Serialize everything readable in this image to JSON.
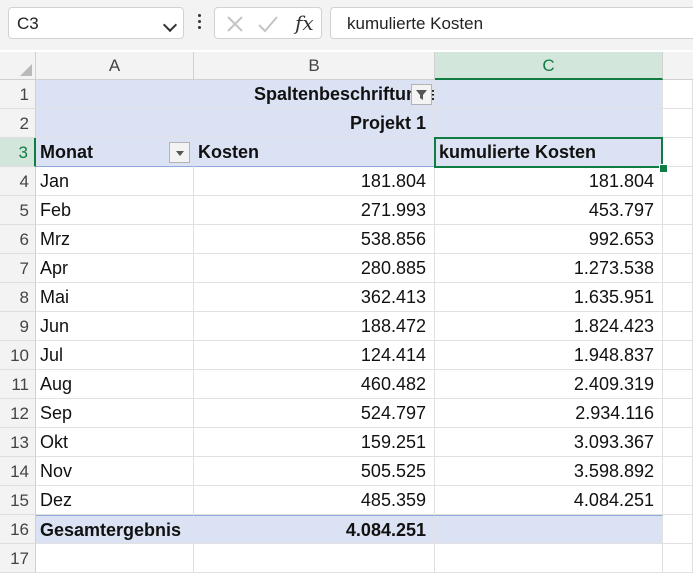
{
  "formula_bar": {
    "name_box": "C3",
    "formula": "kumulierte Kosten",
    "icons": [
      "cancel-x-icon",
      "confirm-check-icon",
      "fx-icon",
      "chevron-down-icon",
      "more-options-icon"
    ]
  },
  "columns": [
    "A",
    "B",
    "C"
  ],
  "selected_column": "C",
  "selected_row": "3",
  "pivot": {
    "column_labels_header": "Spaltenbeschriftungen",
    "project_label": "Projekt 1",
    "row_field": "Monat",
    "value_header_b": "Kosten",
    "value_header_c": "kumulierte Kosten",
    "rows": [
      {
        "month": "Jan",
        "cost": "181.804",
        "cum": "181.804"
      },
      {
        "month": "Feb",
        "cost": "271.993",
        "cum": "453.797"
      },
      {
        "month": "Mrz",
        "cost": "538.856",
        "cum": "992.653"
      },
      {
        "month": "Apr",
        "cost": "280.885",
        "cum": "1.273.538"
      },
      {
        "month": "Mai",
        "cost": "362.413",
        "cum": "1.635.951"
      },
      {
        "month": "Jun",
        "cost": "188.472",
        "cum": "1.824.423"
      },
      {
        "month": "Jul",
        "cost": "124.414",
        "cum": "1.948.837"
      },
      {
        "month": "Aug",
        "cost": "460.482",
        "cum": "2.409.319"
      },
      {
        "month": "Sep",
        "cost": "524.797",
        "cum": "2.934.116"
      },
      {
        "month": "Okt",
        "cost": "159.251",
        "cum": "3.093.367"
      },
      {
        "month": "Nov",
        "cost": "505.525",
        "cum": "3.598.892"
      },
      {
        "month": "Dez",
        "cost": "485.359",
        "cum": "4.084.251"
      }
    ],
    "total_label": "Gesamtergebnis",
    "total_value": "4.084.251"
  },
  "row_numbers": [
    "1",
    "2",
    "3",
    "4",
    "5",
    "6",
    "7",
    "8",
    "9",
    "10",
    "11",
    "12",
    "13",
    "14",
    "15",
    "16",
    "17"
  ]
}
